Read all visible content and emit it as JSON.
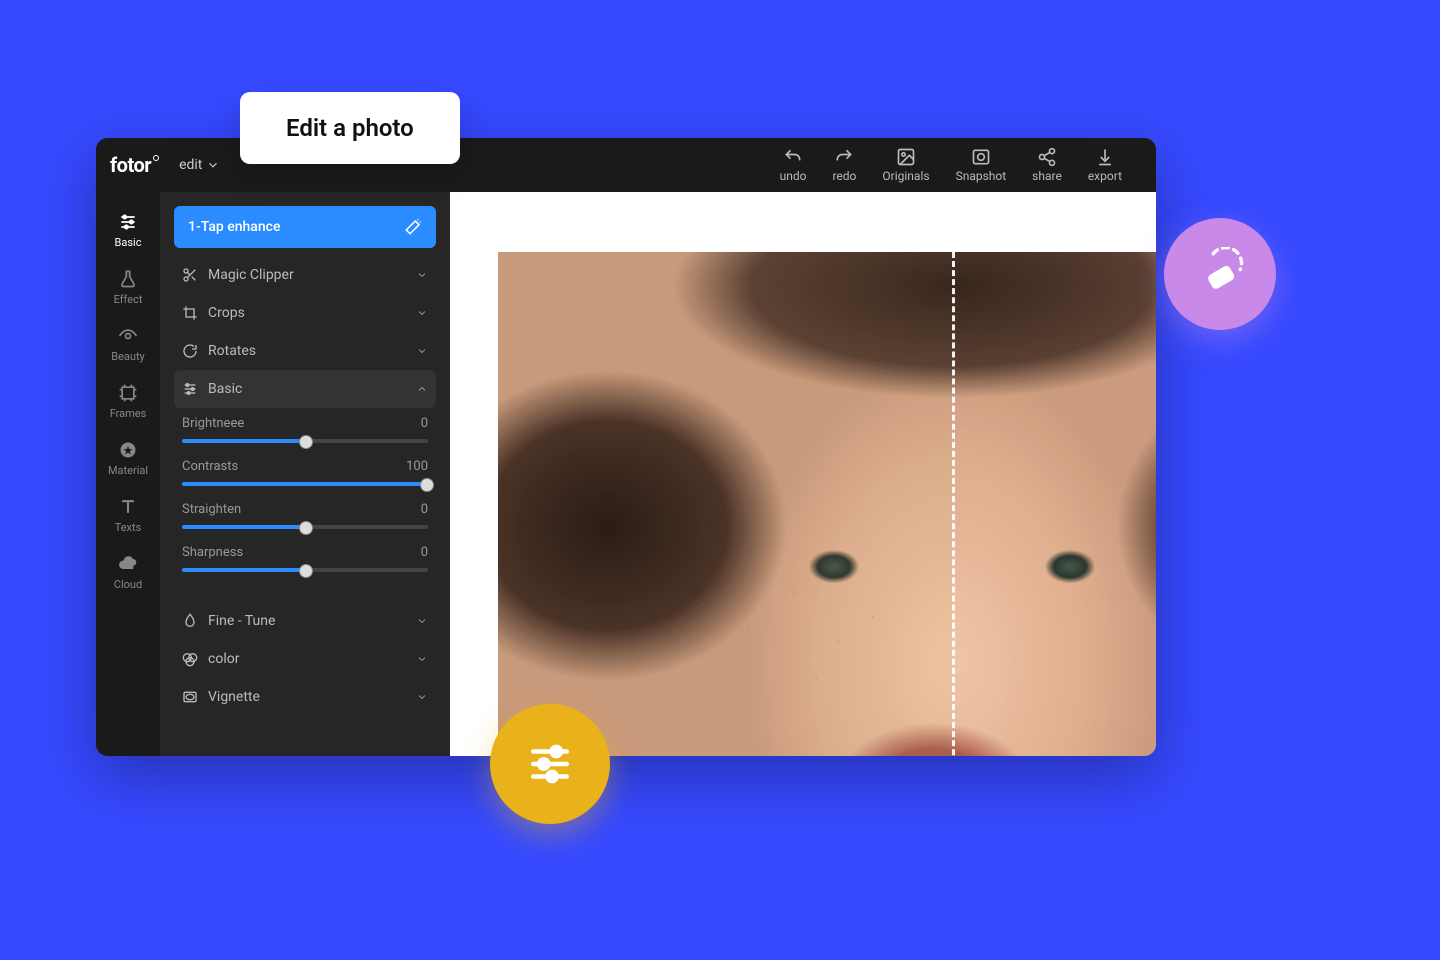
{
  "callout": "Edit a photo",
  "logo": "fotor",
  "menu": {
    "edit": "edit"
  },
  "top_actions": {
    "undo": "undo",
    "redo": "redo",
    "originals": "Originals",
    "snapshot": "Snapshot",
    "share": "share",
    "export": "export"
  },
  "rail": {
    "basic": "Basic",
    "effect": "Effect",
    "beauty": "Beauty",
    "frames": "Frames",
    "material": "Material",
    "texts": "Texts",
    "cloud": "Cloud"
  },
  "panel": {
    "enhance": "1-Tap enhance",
    "magic_clipper": "Magic Clipper",
    "crops": "Crops",
    "rotates": "Rotates",
    "basic": "Basic",
    "fine_tune": "Fine - Tune",
    "color": "color",
    "vignette": "Vignette"
  },
  "sliders": {
    "brightness": {
      "label": "Brightneee",
      "value": "0"
    },
    "contrasts": {
      "label": "Contrasts",
      "value": "100"
    },
    "straighten": {
      "label": "Straighten",
      "value": "0"
    },
    "sharpness": {
      "label": "Sharpness",
      "value": "0"
    }
  }
}
